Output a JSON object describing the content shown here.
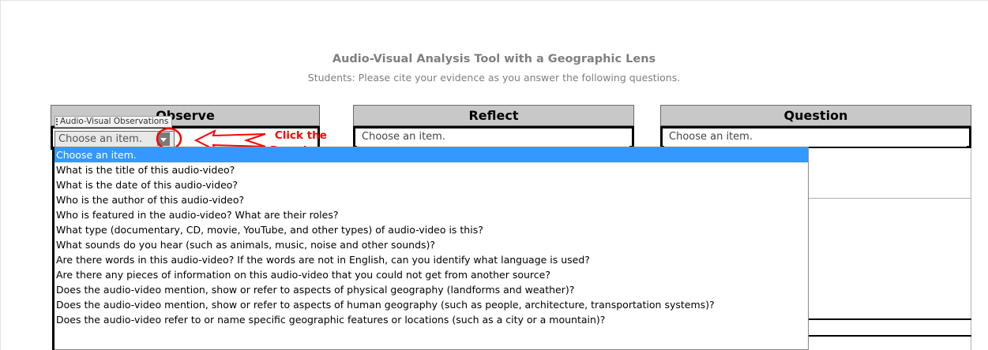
{
  "header": {
    "title": "Audio-Visual Analysis Tool with a Geographic Lens",
    "subtitle": "Students:  Please cite your evidence as you answer the following questions."
  },
  "columns": {
    "observe": "Observe",
    "reflect": "Reflect",
    "question": "Question"
  },
  "content_control": {
    "tag_label": "Audio-Visual Observations",
    "observe_value": "Choose an item.",
    "reflect_value": "Choose an item.",
    "question_value": "Choose an item."
  },
  "annotation": {
    "line1": "Click the",
    "line2": "Dropdown",
    "color": "#ff0000"
  },
  "dropdown": {
    "items": [
      "Choose an item.",
      "What is the title of this audio-video?",
      "What is the date of this audio-video?",
      "Who is the author of this audio-video?",
      "Who is featured in the audio-video? What are their roles?",
      "What type (documentary, CD, movie, YouTube, and other types) of audio-video is this?",
      "What sounds do you hear (such as animals, music, noise and other sounds)?",
      "Are there words in this audio-video?  If the words are not in English, can you identify what language is used?",
      "Are there any pieces of information on this audio-video that you could not get from another source?",
      "Does the audio-video mention, show or refer to aspects of physical geography (landforms and weather)?",
      "Does the audio-video mention, show or refer to aspects of human geography (such as people, architecture, transportation systems)?",
      "Does the audio-video refer to or name specific geographic features or locations (such as a city or a mountain)?"
    ],
    "selected_index": 0,
    "highlight_color": "#3399ff"
  }
}
